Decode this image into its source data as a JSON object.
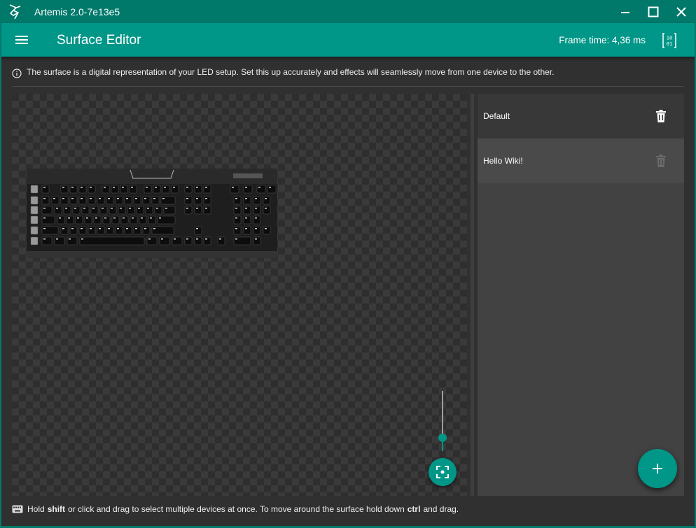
{
  "window": {
    "title": "Artemis 2.0-7e13e5"
  },
  "appbar": {
    "title": "Surface Editor",
    "frame_time": "Frame time: 4,36 ms"
  },
  "info": {
    "text": "The surface is a digital representation of your LED setup. Set this up accurately and effects will seamlessly move from one device to the other."
  },
  "surface": {
    "zoom_level": 0.22,
    "device_icon": "keyboard"
  },
  "configurations": [
    {
      "name": "Default",
      "selected": true,
      "can_delete": true
    },
    {
      "name": "Hello Wiki!",
      "selected": false,
      "can_delete": false
    }
  ],
  "footer": {
    "part1": "Hold",
    "key1": "shift",
    "part2": "or click and drag to select multiple devices at once. To move around the surface hold down",
    "key2": "ctrl",
    "part3": "and drag."
  },
  "colors": {
    "accent": "#009688",
    "titlebar": "#00796b",
    "background": "#303030",
    "panel": "#424242"
  },
  "icons": {
    "menu": "hamburger-icon",
    "debug": "binary-icon",
    "info": "info-icon",
    "delete": "trash-icon",
    "add": "plus-icon",
    "reset_zoom": "fit-screen-icon",
    "hint": "keyboard-icon"
  }
}
